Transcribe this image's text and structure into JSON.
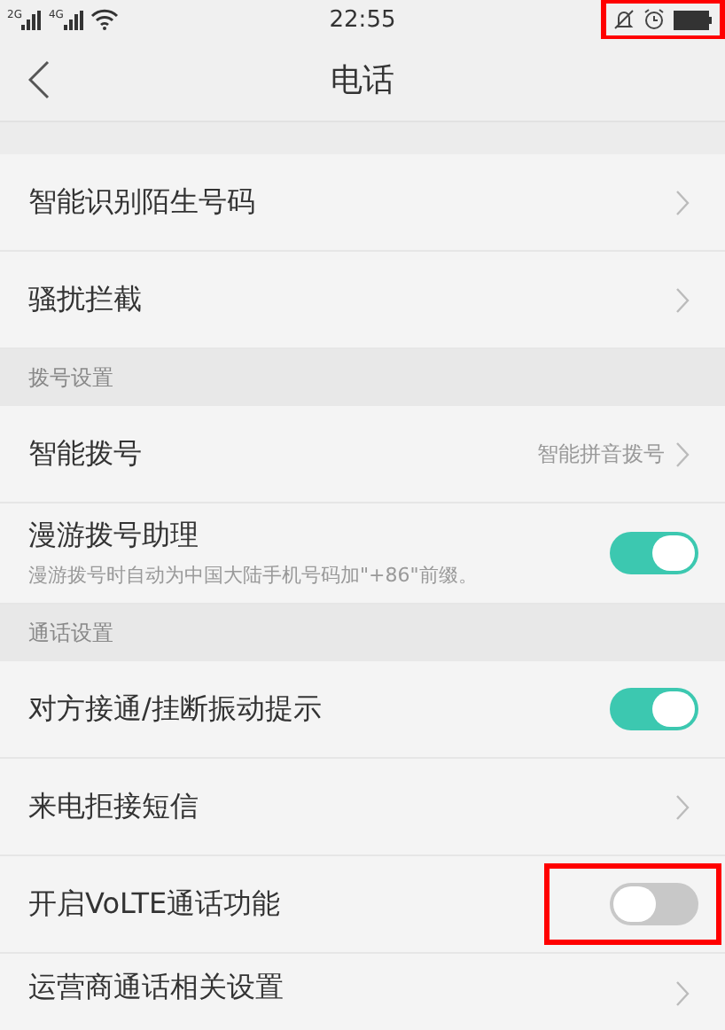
{
  "status_bar": {
    "signal_labels": [
      "2G",
      "4G"
    ],
    "time": "22:55",
    "icons_highlighted": true
  },
  "header": {
    "title": "电话"
  },
  "sections": [
    {
      "items": [
        {
          "kind": "link",
          "label": "智能识别陌生号码"
        },
        {
          "kind": "link",
          "label": "骚扰拦截"
        }
      ]
    },
    {
      "title": "拨号设置",
      "items": [
        {
          "kind": "link",
          "label": "智能拨号",
          "value": "智能拼音拨号"
        },
        {
          "kind": "toggle",
          "label": "漫游拨号助理",
          "description": "漫游拨号时自动为中国大陆手机号码加\"+86\"前缀。",
          "on": true,
          "highlighted": false
        }
      ]
    },
    {
      "title": "通话设置",
      "items": [
        {
          "kind": "toggle",
          "label": "对方接通/挂断振动提示",
          "on": true,
          "highlighted": false
        },
        {
          "kind": "link",
          "label": "来电拒接短信"
        },
        {
          "kind": "toggle",
          "label": "开启VoLTE通话功能",
          "on": false,
          "highlighted": true
        },
        {
          "kind": "link",
          "label": "运营商通话相关设置"
        }
      ]
    }
  ]
}
